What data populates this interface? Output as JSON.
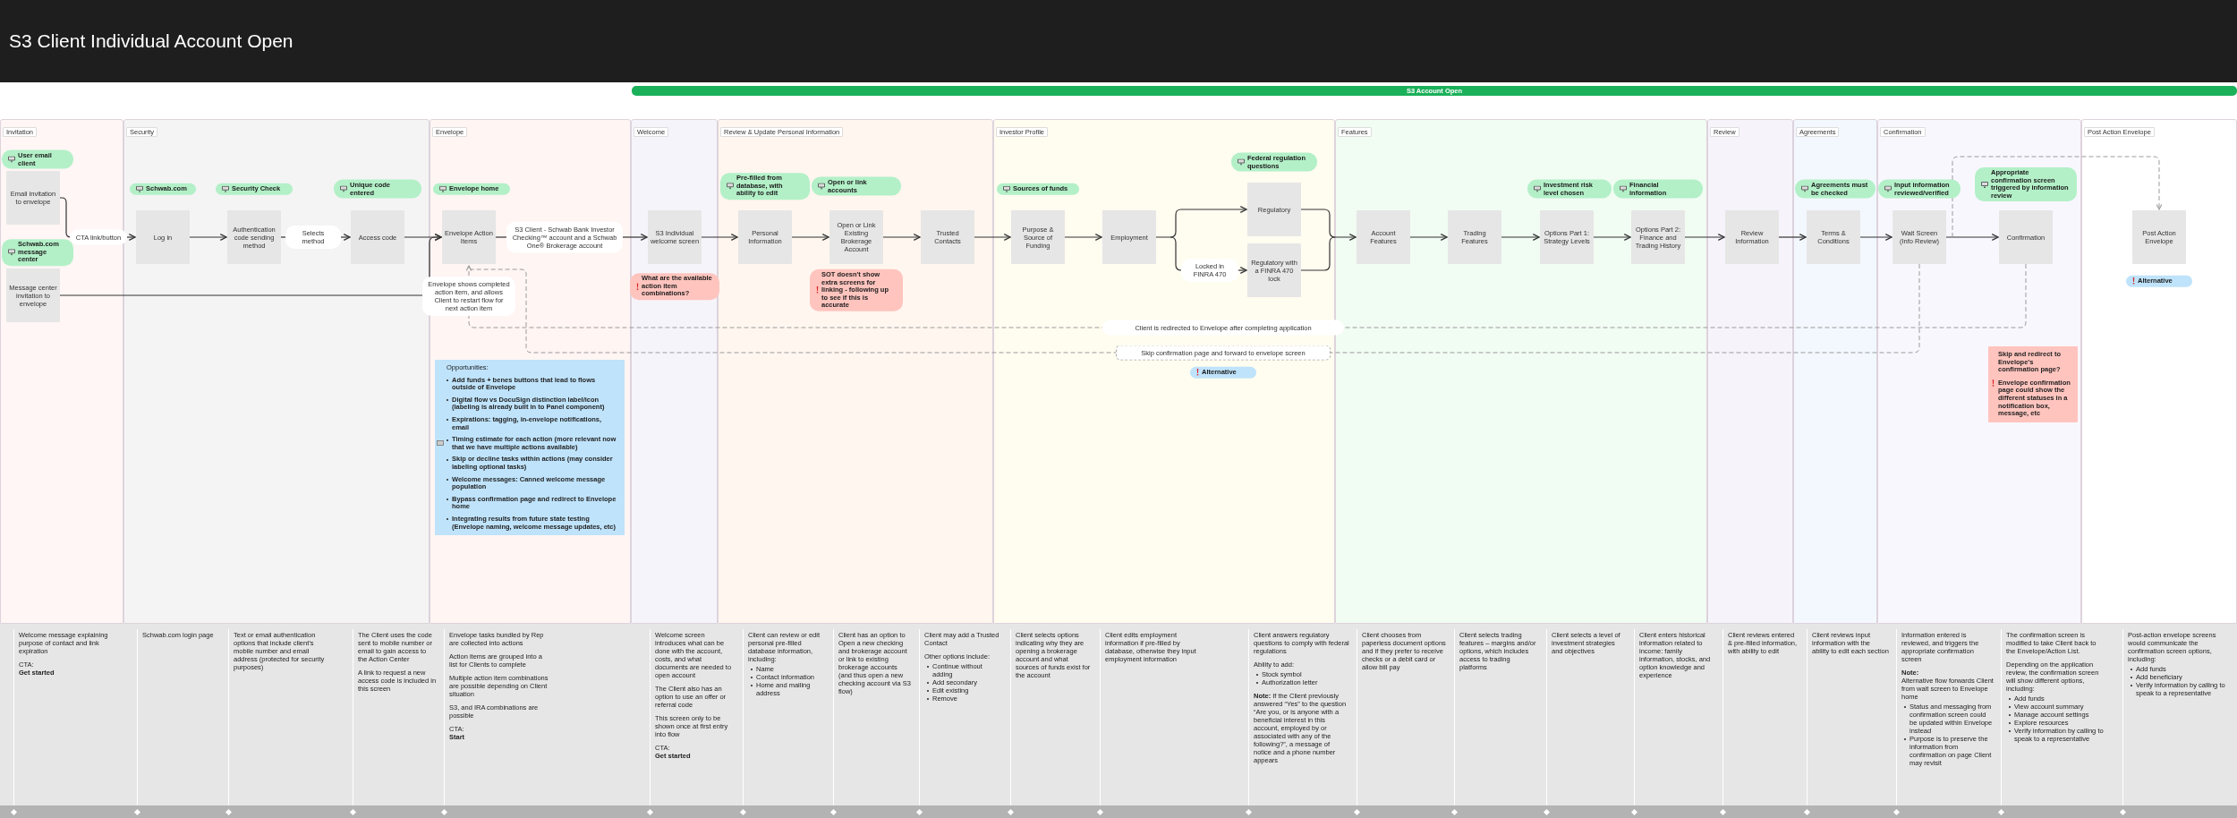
{
  "title": "S3 Client Individual Account Open",
  "phase_bar": {
    "label": "S3 Account Open"
  },
  "lanes": [
    {
      "title": "Invitation",
      "color": "#fff6f5"
    },
    {
      "title": "Security",
      "color": "#f4f4f4"
    },
    {
      "title": "Envelope",
      "color": "#fff5f3"
    },
    {
      "title": "Welcome",
      "color": "#f6f4fb"
    },
    {
      "title": "Review & Update Personal Information",
      "color": "#fff6ef"
    },
    {
      "title": "Investor Profile",
      "color": "#fffcf0"
    },
    {
      "title": "Features",
      "color": "#f1fcf3"
    },
    {
      "title": "Review",
      "color": "#f6f4fa"
    },
    {
      "title": "Agreements",
      "color": "#f3f8fe"
    },
    {
      "title": "Confirmation",
      "color": "#f9f7fe"
    },
    {
      "title": "Post Action Envelope",
      "color": "#ffffff"
    }
  ],
  "screens": [
    {
      "label": "Email invitation to envelope"
    },
    {
      "label": "Message center invitation to envelope"
    },
    {
      "label": "Log in"
    },
    {
      "label": "Authentication code sending method"
    },
    {
      "label": "Access code"
    },
    {
      "label": "Envelope Action Items"
    },
    {
      "label": "S3 Individual welcome screen"
    },
    {
      "label": "Personal Information"
    },
    {
      "label": "Open or Link Existing Brokerage Account"
    },
    {
      "label": "Trusted Contacts"
    },
    {
      "label": "Purpose & Source of Funding"
    },
    {
      "label": "Employment"
    },
    {
      "label": "Regulatory"
    },
    {
      "label": "Regulatory with a FINRA 470 lock"
    },
    {
      "label": "Account Features"
    },
    {
      "label": "Trading Features"
    },
    {
      "label": "Options Part 1: Strategy Levels"
    },
    {
      "label": "Options Part 2: Finance and Trading History"
    },
    {
      "label": "Review Information"
    },
    {
      "label": "Terms & Conditions"
    },
    {
      "label": "Wait Screen (Info  Review)"
    },
    {
      "label": "Confirmation"
    },
    {
      "label": "Post Action Envelope"
    }
  ],
  "tags": [
    {
      "kind": "screen",
      "text": "User email client"
    },
    {
      "kind": "screen",
      "text": "Schwab.com message center"
    },
    {
      "kind": "screen",
      "text": "Schwab.com"
    },
    {
      "kind": "screen",
      "text": "Security Check"
    },
    {
      "kind": "screen",
      "text": "Unique code entered"
    },
    {
      "kind": "screen",
      "text": "Envelope home"
    },
    {
      "kind": "question",
      "text": "What are the available action item combinations?"
    },
    {
      "kind": "screen",
      "text": "Pre-filled from database, with ability to edit"
    },
    {
      "kind": "screen",
      "text": "Open or link accounts"
    },
    {
      "kind": "question",
      "text": "SOT doesn't show extra screens for linking - following up to see if this is accurate"
    },
    {
      "kind": "screen",
      "text": "Sources of funds"
    },
    {
      "kind": "screen",
      "text": "Federal regulation questions"
    },
    {
      "kind": "screen",
      "text": "Investment risk level chosen"
    },
    {
      "kind": "screen",
      "text": "Financial information"
    },
    {
      "kind": "screen",
      "text": "Agreements must be checked"
    },
    {
      "kind": "screen",
      "text": "Input information reviewed/verified"
    },
    {
      "kind": "screen",
      "text": "Appropriate confirmation screen triggered by information review"
    },
    {
      "kind": "alternative",
      "text": "Alternative"
    },
    {
      "kind": "alternative",
      "text": "Alternative"
    }
  ],
  "edge_labels": [
    {
      "kind": "bubble",
      "text": "CTA link/button"
    },
    {
      "kind": "bubble",
      "text": "Selects method"
    },
    {
      "kind": "bubble",
      "text": "S3 Client - Schwab Bank Investor Checking™ account and a Schwab One® Brokerage account"
    },
    {
      "kind": "bubble",
      "text": "Envelope shows completed action item, and allows Client to restart flow for next action item"
    },
    {
      "kind": "bubble",
      "text": "Locked in FINRA 470"
    },
    {
      "kind": "bubble",
      "text": "Client is redirected to Envelope after completing application"
    },
    {
      "kind": "dashed",
      "text": "Skip confirmation page and forward to envelope screen"
    }
  ],
  "opportunities": {
    "title": "Opportunities:",
    "items": [
      "Add funds + benes buttons that lead to flows outside of Envelope",
      "Digital flow vs DocuSign distinction label/icon (labeling is already built in to Panel component)",
      "Expirations: tagging, in-envelope notifications, email",
      "Timing estimate for each action (more relevant now that we have multiple actions available)",
      "Skip or decline tasks within actions (may consider labeling optional tasks)",
      "Welcome messages: Canned welcome message population",
      "Bypass confirmation page and redirect to Envelope home",
      "Integrating results from future state testing (Envelope naming, welcome message updates, etc)"
    ]
  },
  "warning_note": {
    "paragraphs": [
      "Skip and redirect to Envelope’s confirmation page?",
      "Envelope confirmation page could show the different statuses in a notification box, message, etc"
    ]
  },
  "descriptions": [
    {
      "blocks": [
        {
          "kind": "text",
          "text": "Welcome message explaining purpose of contact and link expiration"
        },
        {
          "kind": "cta",
          "label": "CTA:",
          "value": "Get started"
        }
      ]
    },
    {
      "blocks": [
        {
          "kind": "text",
          "text": "Schwab.com login page"
        }
      ]
    },
    {
      "blocks": [
        {
          "kind": "text",
          "text": "Text or email authentication options that include client’s mobile number and email address (protected for security purposes)"
        }
      ]
    },
    {
      "blocks": [
        {
          "kind": "text",
          "text": "The Client uses the code sent to mobile number or email to gain access to the Action Center"
        },
        {
          "kind": "text",
          "text": "A link to request a new access code is included in this screen"
        }
      ]
    },
    {
      "blocks": [
        {
          "kind": "text",
          "text": "Envelope tasks bundled by Rep are collected into actions"
        },
        {
          "kind": "text",
          "text": "Action items are grouped into a list for Clients to complete"
        },
        {
          "kind": "text",
          "text": "Multiple action item combinations are possible depending on Client situation"
        },
        {
          "kind": "text",
          "text": "S3, and IRA combinations are possible"
        },
        {
          "kind": "cta",
          "label": "CTA:",
          "value": "Start"
        }
      ]
    },
    {
      "blocks": [
        {
          "kind": "text",
          "text": "Welcome screen introduces what can be done with the account, costs, and what documents are needed to open account"
        },
        {
          "kind": "text",
          "text": "The Client also has an option to use an offer or referral code"
        },
        {
          "kind": "text",
          "text": "This screen only to be shown once at first entry into flow"
        },
        {
          "kind": "cta",
          "label": "CTA:",
          "value": "Get started"
        }
      ]
    },
    {
      "blocks": [
        {
          "kind": "text",
          "text": "Client can review or edit personal pre-filled database information, including:"
        },
        {
          "kind": "list",
          "items": [
            "Name",
            "Contact information",
            "Home and mailing address"
          ]
        }
      ]
    },
    {
      "blocks": [
        {
          "kind": "text",
          "text": "Client has an option to Open a new checking and brokerage account or link to existing brokerage accounts (and thus open a new checking account via S3 flow)"
        }
      ]
    },
    {
      "blocks": [
        {
          "kind": "text",
          "text": "Client may add a Trusted Contact"
        },
        {
          "kind": "text",
          "text": "Other options include:"
        },
        {
          "kind": "list",
          "items": [
            "Continue without adding",
            "Add secondary",
            "Edit existing",
            "Remove"
          ]
        }
      ]
    },
    {
      "blocks": [
        {
          "kind": "text",
          "text": "Client selects options indicating why they are opening a brokerage account and what sources of funds exist for the account"
        }
      ]
    },
    {
      "blocks": [
        {
          "kind": "text",
          "text": "Client edits employment information if pre-filled by database, otherwise they input employment information"
        }
      ]
    },
    {
      "blocks": [
        {
          "kind": "text",
          "text": "Client answers regulatory questions to comply with federal regulations"
        },
        {
          "kind": "text",
          "text": "Ability to add:"
        },
        {
          "kind": "list",
          "items": [
            "Stock symbol",
            "Authorization letter"
          ]
        },
        {
          "kind": "text",
          "text": "**Note:** If the Client previously answered “Yes” to  the question “Are you, or is anyone with a beneficial interest in this account, employed by or associated with any of the following?”, a message of notice and a phone number appears"
        }
      ]
    },
    {
      "blocks": [
        {
          "kind": "text",
          "text": "Client chooses from paperless document options and if they prefer to receive checks or a debit card or allow bill pay"
        }
      ]
    },
    {
      "blocks": [
        {
          "kind": "text",
          "text": "Client selects trading features – margins and/or options, which includes access to trading platforms"
        }
      ]
    },
    {
      "blocks": [
        {
          "kind": "text",
          "text": "Client selects a level of investment strategies and objectives"
        }
      ]
    },
    {
      "blocks": [
        {
          "kind": "text",
          "text": "Client enters historical information related to income: family information, stocks, and option knowledge and experience"
        }
      ]
    },
    {
      "blocks": [
        {
          "kind": "text",
          "text": "Client reviews entered & pre-filled information, with ability to edit"
        }
      ]
    },
    {
      "blocks": [
        {
          "kind": "text",
          "text": "Client reviews input information with the ability to edit each section"
        }
      ]
    },
    {
      "blocks": [
        {
          "kind": "text",
          "text": "Information entered is reviewed, and triggers the appropriate confirmation screen"
        },
        {
          "kind": "heading",
          "text": "Note:"
        },
        {
          "kind": "text",
          "text": "Alternative flow forwards Client from wait screen to Envelope home"
        },
        {
          "kind": "list",
          "items": [
            "Status and messaging from confirmation screen could be updated within Envelope instead",
            "Purpose is to preserve the information from confirmation on page Client may revisit"
          ]
        }
      ]
    },
    {
      "blocks": [
        {
          "kind": "text",
          "text": "The confirmation screen is modified to take Client back to the Envelope/Action List."
        },
        {
          "kind": "text",
          "text": "Depending on the application review, the confirmation screen will show different options, including:"
        },
        {
          "kind": "list",
          "items": [
            "Add funds",
            "View account summary",
            "Manage account settings",
            "Explore resources",
            "Verify information by calling to speak to a representative"
          ]
        }
      ]
    },
    {
      "blocks": [
        {
          "kind": "text",
          "text": "Post-action envelope screens would communicate the confirmation screen options, including:"
        },
        {
          "kind": "list",
          "items": [
            "Add funds",
            "Add beneficiary",
            "Verify information by calling to speak to a representative"
          ]
        }
      ]
    }
  ]
}
